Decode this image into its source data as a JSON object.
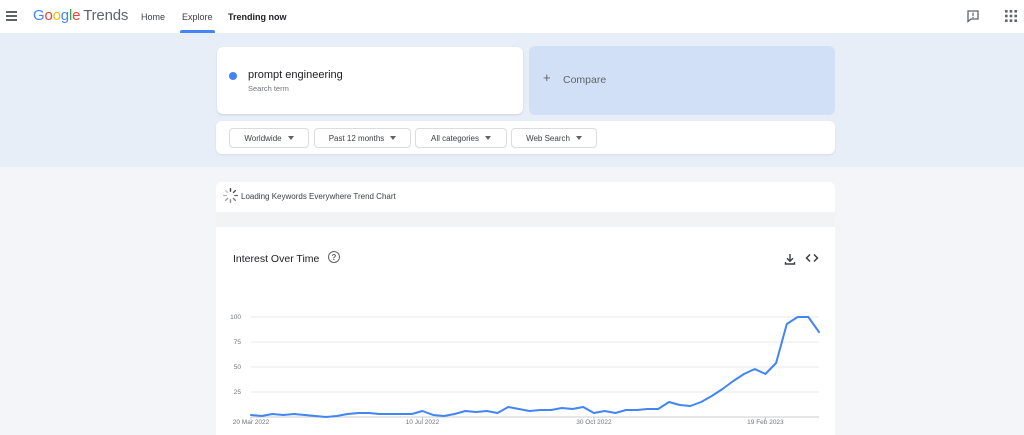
{
  "header": {
    "logo_google": "Google",
    "logo_trends": "Trends",
    "nav": [
      {
        "label": "Home"
      },
      {
        "label": "Explore"
      },
      {
        "label": "Trending now"
      }
    ],
    "icons": [
      "menu-icon",
      "feedback-icon",
      "apps-grid-icon"
    ]
  },
  "explore": {
    "term": {
      "name": "prompt engineering",
      "subtitle": "Search term",
      "color": "#4285f4"
    },
    "compare_plus": "+",
    "compare_label": "Compare",
    "filters": [
      {
        "label": "Worldwide"
      },
      {
        "label": "Past 12 months"
      },
      {
        "label": "All categories"
      },
      {
        "label": "Web Search"
      }
    ]
  },
  "loading": {
    "text": "Loading Keywords Everywhere Trend Chart"
  },
  "interest_card": {
    "title": "Interest Over Time",
    "help_glyph": "?",
    "icons": [
      "download-icon",
      "embed-code-icon"
    ]
  },
  "chart_data": {
    "type": "line",
    "line_color": "#4285f4",
    "grid": true,
    "y_ticks": [
      25,
      50,
      75,
      100
    ],
    "ylim": [
      0,
      100
    ],
    "x_tick_labels": [
      "20 Mar 2022",
      "10 Jul 2022",
      "30 Oct 2022",
      "19 Feb 2023"
    ],
    "x_tick_index": [
      0,
      16,
      32,
      48
    ],
    "series": [
      {
        "values": [
          2,
          1,
          3,
          2,
          3,
          2,
          1,
          0,
          1,
          3,
          4,
          4,
          3,
          3,
          3,
          3,
          6,
          2,
          1,
          3,
          6,
          5,
          6,
          4,
          10,
          8,
          6,
          7,
          7,
          9,
          8,
          10,
          4,
          6,
          4,
          7,
          7,
          8,
          8,
          15,
          12,
          11,
          15,
          21,
          28,
          36,
          43,
          48,
          43,
          54,
          93,
          100,
          100,
          85
        ]
      }
    ]
  }
}
